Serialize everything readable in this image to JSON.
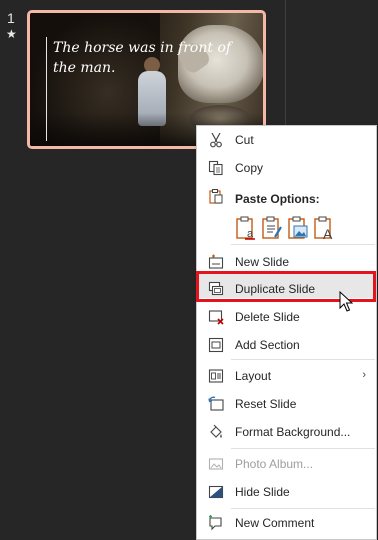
{
  "slide_panel": {
    "slide_number": "1",
    "slide_marker": "★",
    "slide_caption": "The horse was in front of the man."
  },
  "context_menu": {
    "cut": "Cut",
    "copy": "Copy",
    "paste_options": "Paste Options:",
    "new_slide": "New Slide",
    "duplicate_slide": "Duplicate Slide",
    "delete_slide": "Delete Slide",
    "add_section": "Add Section",
    "layout": "Layout",
    "reset_slide": "Reset Slide",
    "format_background": "Format Background...",
    "photo_album": "Photo Album...",
    "hide_slide": "Hide Slide",
    "new_comment": "New Comment",
    "submenu_arrow": "›"
  },
  "icons": {
    "cut": "scissors-icon",
    "copy": "copy-icon",
    "paste": "clipboard-icon",
    "paste_keep_source": "paste-keep-source-icon",
    "paste_use_destination": "paste-use-destination-icon",
    "paste_picture": "paste-picture-icon",
    "paste_text_only": "paste-text-only-icon",
    "new_slide": "new-slide-icon",
    "duplicate_slide": "duplicate-slide-icon",
    "delete_slide": "delete-slide-icon",
    "add_section": "add-section-icon",
    "layout": "layout-icon",
    "reset_slide": "reset-slide-icon",
    "format_background": "format-background-icon",
    "photo_album": "photo-album-icon",
    "hide_slide": "hide-slide-icon",
    "new_comment": "new-comment-icon"
  },
  "colors": {
    "app_background": "#262626",
    "thumbnail_border": "#f4b8a6",
    "highlight_border": "#e3141b",
    "menu_background": "#ffffff",
    "icon_accent": "#c55a11",
    "icon_blue": "#2e75b6"
  },
  "state": {
    "hovered_item": "Duplicate Slide"
  }
}
